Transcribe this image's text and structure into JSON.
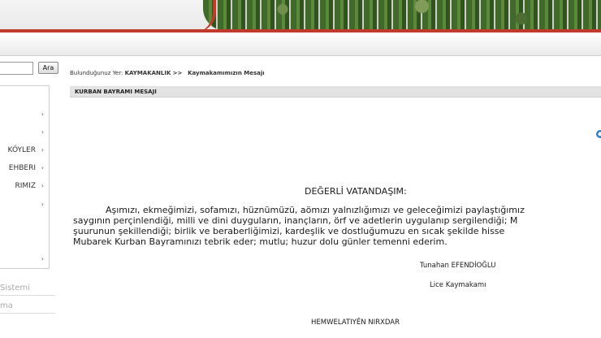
{
  "search": {
    "placeholder": "",
    "button_label": "Ara"
  },
  "sidebar": {
    "items": [
      {
        "label": "",
        "top": 0
      },
      {
        "label": "",
        "top": 0
      },
      {
        "label": "KÖYLER"
      },
      {
        "label": "EHBERI"
      },
      {
        "label": "RIMIZ"
      },
      {
        "label": ""
      },
      {
        "label": ""
      }
    ],
    "links": [
      "Sistemi",
      "ma"
    ]
  },
  "breadcrumb": {
    "prefix": "Bulunduğunuz Yer:",
    "section": "KAYMAKANLIK",
    "separator": ">>",
    "page": "Kaymakamımızın Mesajı"
  },
  "content": {
    "header": "KURBAN BAYRAMI MESAJI",
    "heading": "DEĞERLİ VATANDAŞIM:",
    "paragraph": [
      "Aşımızı, ekmeğimizi, sofamızı, hüznümüzü, aömızı yalnızlığımızı ve geleceğimizi paylaştığımız",
      "saygının perçinlendiği, milli ve dini duyguların, inançların, örf ve adetlerin uygulanıp sergilendiği; M",
      "şuurunun şekillendiği; birlik ve beraberliğimizi, kardeşlik ve dostluğumuzu en sıcak şekilde hisse",
      "Mubarek Kurban Bayramınızı tebrik eder; mutlu; huzur dolu günler temenni ederim."
    ],
    "signature_name": "Tunahan  EFENDİOĞLU",
    "signature_title": "Lice Kaymakamı",
    "kurdish_heading": "HEMWELATIYÊN NIRXDAR"
  },
  "colors": {
    "accent_red": "#c23a2c",
    "header_gray": "#e3e3e3"
  }
}
